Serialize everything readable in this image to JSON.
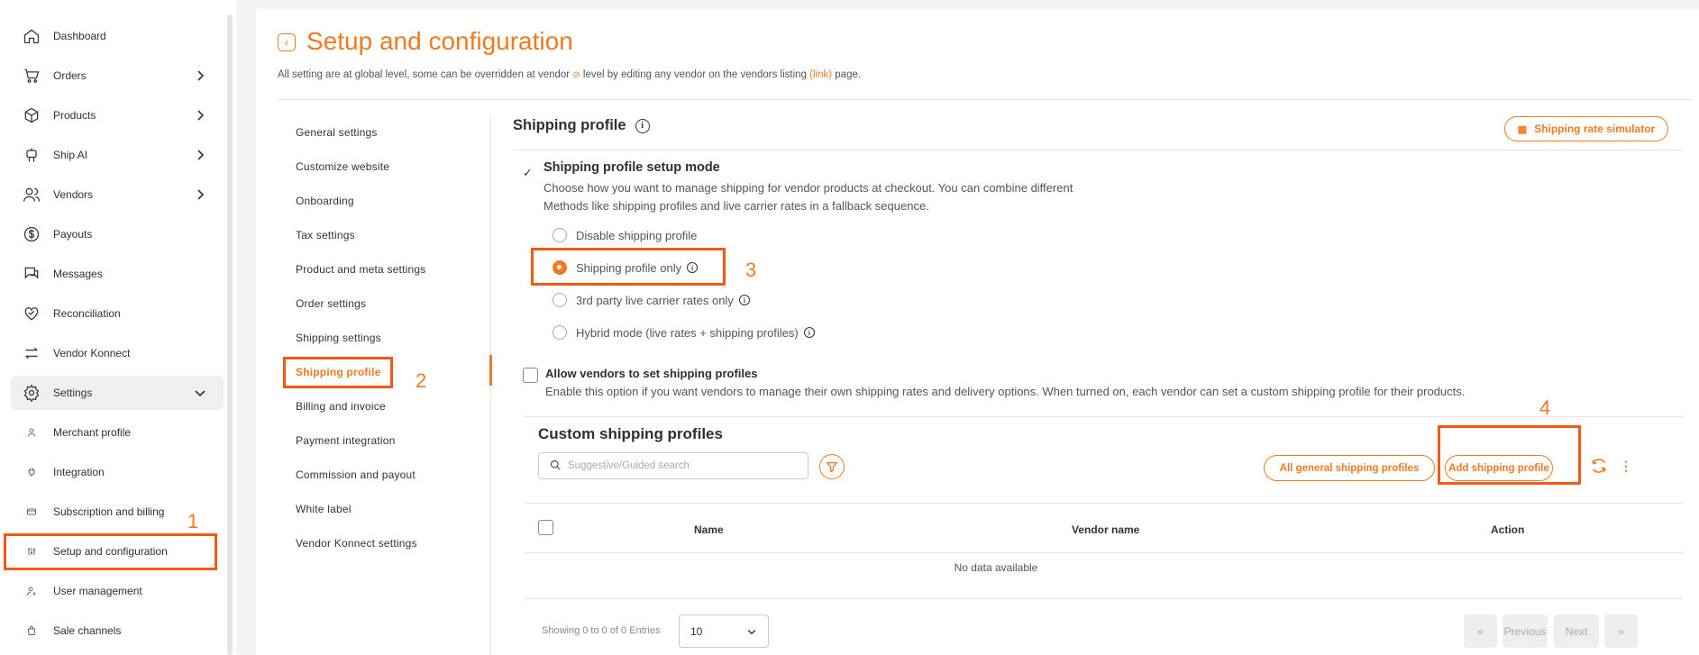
{
  "sidebar": {
    "items": [
      {
        "label": "Dashboard",
        "icon": "home-icon"
      },
      {
        "label": "Orders",
        "icon": "cart-icon"
      },
      {
        "label": "Products",
        "icon": "box-icon"
      },
      {
        "label": "Ship AI",
        "icon": "robot-icon"
      },
      {
        "label": "Vendors",
        "icon": "users-icon"
      },
      {
        "label": "Payouts",
        "icon": "dollar-icon"
      },
      {
        "label": "Messages",
        "icon": "chat-icon"
      },
      {
        "label": "Reconciliation",
        "icon": "heart-handshake-icon"
      },
      {
        "label": "Vendor Konnect",
        "icon": "arrows-exchange-icon"
      },
      {
        "label": "Settings",
        "icon": "gear-icon"
      }
    ],
    "sub_items": [
      {
        "label": "Merchant profile"
      },
      {
        "label": "Integration"
      },
      {
        "label": "Subscription and billing"
      },
      {
        "label": "Setup and configuration"
      },
      {
        "label": "User management"
      },
      {
        "label": "Sale channels"
      }
    ]
  },
  "header": {
    "title": "Setup and configuration",
    "desc_a": "All setting are at global level, some can be overridden at vendor",
    "desc_b": "level by editing any vendor on the vendors listing",
    "desc_link": "(link)",
    "desc_c": "page."
  },
  "settings_menu": [
    "General settings",
    "Customize website",
    "Onboarding",
    "Tax settings",
    "Product and meta settings",
    "Order settings",
    "Shipping settings",
    "Shipping profile",
    "Billing and invoice",
    "Payment integration",
    "Commission and payout",
    "White label",
    "Vendor Konnect settings"
  ],
  "content": {
    "section_title": "Shipping profile",
    "simulator_button": "Shipping rate simulator",
    "mode_title": "Shipping profile setup mode",
    "mode_desc": "Choose how you want to manage shipping for vendor products at checkout. You can combine different Methods like shipping profiles and live carrier rates in a fallback sequence.",
    "radios": [
      {
        "label": "Disable shipping profile",
        "selected": false
      },
      {
        "label": "Shipping profile only",
        "selected": true
      },
      {
        "label": "3rd party live carrier rates only",
        "selected": false
      },
      {
        "label": "Hybrid mode (live rates + shipping profiles)",
        "selected": false
      }
    ],
    "allow_title": "Allow vendors to set shipping profiles",
    "allow_desc": "Enable this option if you want vendors to manage their own shipping rates and delivery options. When turned on, each vendor can set a custom shipping profile for their products.",
    "custom_title": "Custom shipping profiles",
    "search_placeholder": "Suggestive/Guided search",
    "all_general_button": "All general shipping profiles",
    "add_button": "Add shipping profile",
    "table": {
      "columns": [
        "Name",
        "Vendor name",
        "Action"
      ],
      "empty": "No data available"
    },
    "pagination": {
      "showing": "Showing 0 to 0 of 0 Entries",
      "per_page": "10",
      "first": "«",
      "previous": "Previous",
      "next": "Next",
      "last": "»"
    }
  },
  "annotations": [
    "1",
    "2",
    "3",
    "4"
  ],
  "colors": {
    "accent": "#f07a22",
    "annotation": "#f05a14"
  }
}
